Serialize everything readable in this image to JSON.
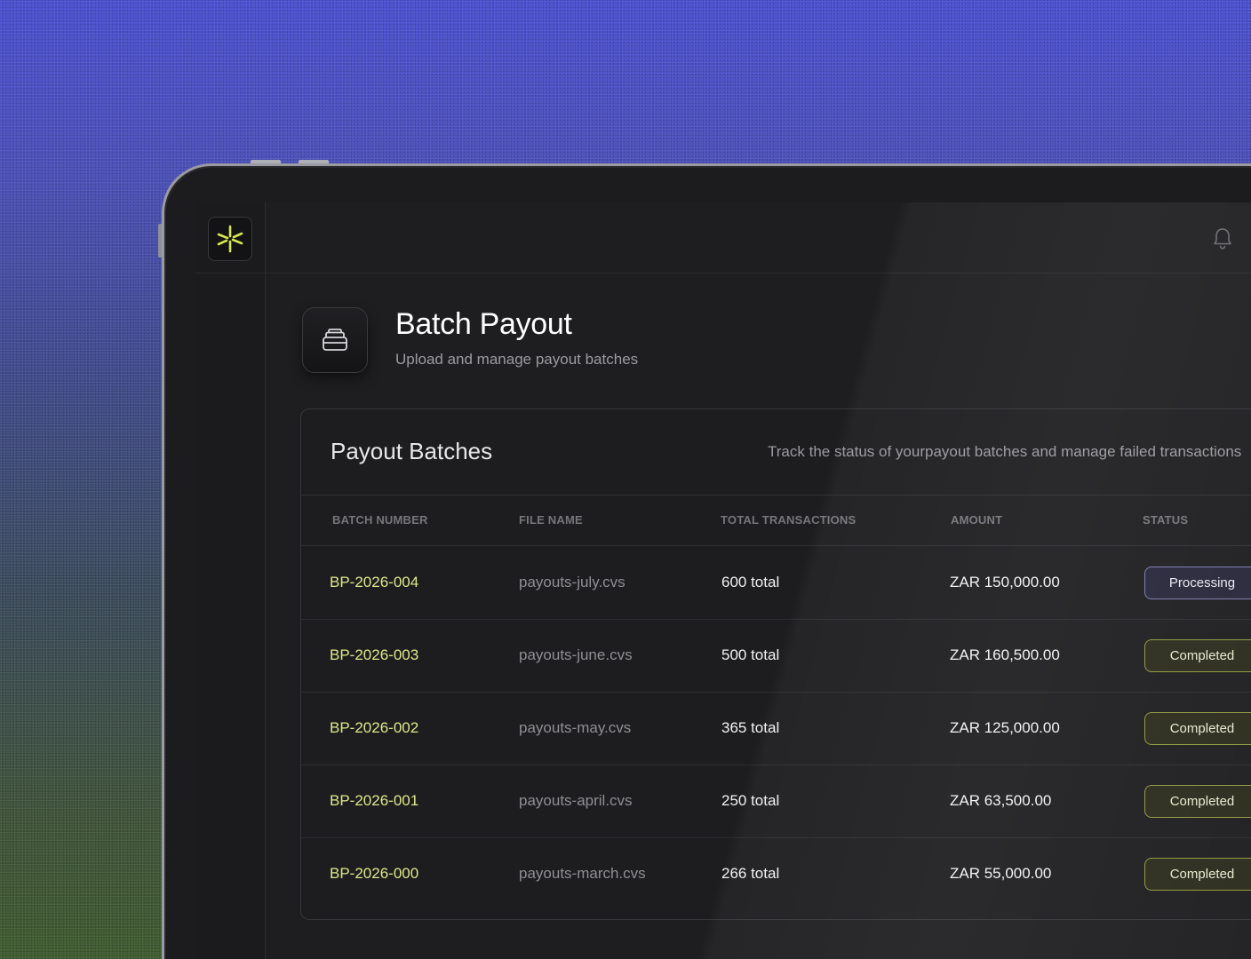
{
  "colors": {
    "accent_yellow": "#dfe88a",
    "processing_border": "#7e7ab0",
    "completed_border": "#8f9a3c",
    "background_top": "#4a4fd0",
    "background_bottom": "#3e5a2e"
  },
  "sidebar": {
    "logo_icon": "asterisk-logo-icon"
  },
  "topbar": {
    "notification_icon": "bell-icon"
  },
  "header": {
    "icon": "stack-icon",
    "title": "Batch Payout",
    "subtitle": "Upload and manage payout batches"
  },
  "card": {
    "title": "Payout Batches",
    "description": "Track the status of yourpayout batches and manage failed transactions"
  },
  "table": {
    "columns": [
      "BATCH NUMBER",
      "FILE NAME",
      "TOTAL TRANSACTIONS",
      "AMOUNT",
      "STATUS"
    ],
    "rows": [
      {
        "batch": "BP-2026-004",
        "file": "payouts-july.cvs",
        "total": "600 total",
        "amount": "ZAR 150,000.00",
        "status": "Processing"
      },
      {
        "batch": "BP-2026-003",
        "file": "payouts-june.cvs",
        "total": "500 total",
        "amount": "ZAR 160,500.00",
        "status": "Completed"
      },
      {
        "batch": "BP-2026-002",
        "file": "payouts-may.cvs",
        "total": "365 total",
        "amount": "ZAR 125,000.00",
        "status": "Completed"
      },
      {
        "batch": "BP-2026-001",
        "file": "payouts-april.cvs",
        "total": "250 total",
        "amount": "ZAR 63,500.00",
        "status": "Completed"
      },
      {
        "batch": "BP-2026-000",
        "file": "payouts-march.cvs",
        "total": "266 total",
        "amount": "ZAR 55,000.00",
        "status": "Completed"
      }
    ]
  }
}
